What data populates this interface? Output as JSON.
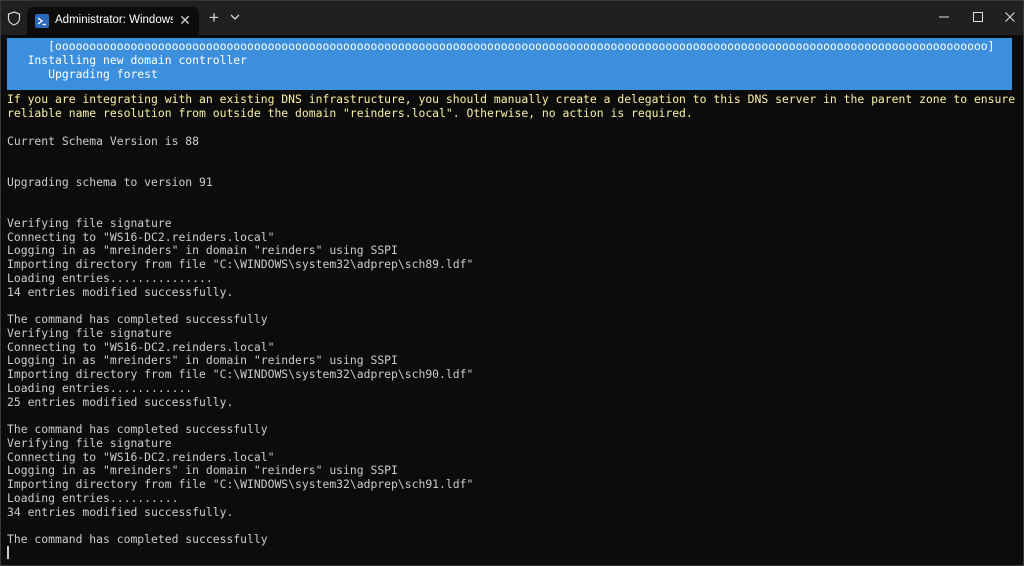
{
  "window": {
    "tab_title": "Administrator: Windows PowerShell",
    "new_tab_label": "+",
    "tab_close_label": "✕"
  },
  "terminal": {
    "progress_lines": [
      "      [oooooooooooooooooooooooooooooooooooooooooooooooooooooooooooooooooooooooooooooooooooooooooooooooooooooooooooooooooooooooooooooooooooooooo]",
      "   Installing new domain controller",
      "      Upgrading forest"
    ],
    "warning_lines": [
      "If you are integrating with an existing DNS infrastructure, you should manually create a delegation to this DNS server in the parent zone to ensure",
      "reliable name resolution from outside the domain \"reinders.local\". Otherwise, no action is required."
    ],
    "lines": [
      "",
      "Current Schema Version is 88",
      "",
      "",
      "Upgrading schema to version 91",
      "",
      "",
      "Verifying file signature",
      "Connecting to \"WS16-DC2.reinders.local\"",
      "Logging in as \"mreinders\" in domain \"reinders\" using SSPI",
      "Importing directory from file \"C:\\WINDOWS\\system32\\adprep\\sch89.ldf\"",
      "Loading entries...............",
      "14 entries modified successfully.",
      "",
      "The command has completed successfully",
      "Verifying file signature",
      "Connecting to \"WS16-DC2.reinders.local\"",
      "Logging in as \"mreinders\" in domain \"reinders\" using SSPI",
      "Importing directory from file \"C:\\WINDOWS\\system32\\adprep\\sch90.ldf\"",
      "Loading entries............",
      "25 entries modified successfully.",
      "",
      "The command has completed successfully",
      "Verifying file signature",
      "Connecting to \"WS16-DC2.reinders.local\"",
      "Logging in as \"mreinders\" in domain \"reinders\" using SSPI",
      "Importing directory from file \"C:\\WINDOWS\\system32\\adprep\\sch91.ldf\"",
      "Loading entries..........",
      "34 entries modified successfully.",
      "",
      "The command has completed successfully"
    ]
  },
  "colors": {
    "background": "#0c0c0c",
    "titlebar": "#202020",
    "progress_background": "#3c8fdc",
    "warning_text": "#f9f1a5",
    "output_text": "#cccccc"
  },
  "icons": [
    "shield-icon",
    "powershell-icon",
    "close-icon",
    "plus-icon",
    "chevron-down-icon",
    "minimize-icon",
    "maximize-icon",
    "window-close-icon"
  ]
}
